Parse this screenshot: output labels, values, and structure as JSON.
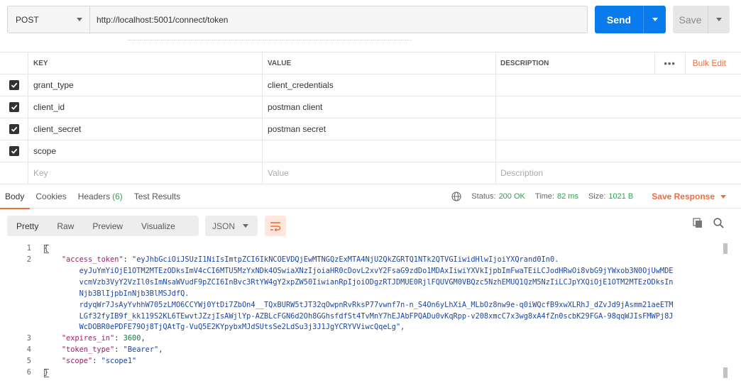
{
  "request": {
    "method": "POST",
    "url": "http://localhost:5001/connect/token",
    "send_label": "Send",
    "save_label": "Save"
  },
  "params": {
    "headers": {
      "key": "KEY",
      "value": "VALUE",
      "description": "DESCRIPTION",
      "more": "•••",
      "bulk_edit": "Bulk Edit"
    },
    "rows": [
      {
        "key": "grant_type",
        "value": "client_credentials",
        "checked": true
      },
      {
        "key": "client_id",
        "value": "postman client",
        "checked": true
      },
      {
        "key": "client_secret",
        "value": "postman secret",
        "checked": true
      },
      {
        "key": "scope",
        "value": "",
        "checked": true
      }
    ],
    "placeholders": {
      "key": "Key",
      "value": "Value",
      "description": "Description"
    }
  },
  "response_tabs": {
    "body": "Body",
    "cookies": "Cookies",
    "headers": "Headers",
    "headers_count": "(6)",
    "test_results": "Test Results"
  },
  "response_meta": {
    "status_label": "Status:",
    "status": "200 OK",
    "time_label": "Time:",
    "time": "82 ms",
    "size_label": "Size:",
    "size": "1021 B",
    "save_response": "Save Response"
  },
  "view_modes": [
    "Pretty",
    "Raw",
    "Preview",
    "Visualize"
  ],
  "format": "JSON",
  "colors": {
    "accent": "#f26b3a",
    "send": "#097bed",
    "ok": "#28a745"
  },
  "code": {
    "line_numbers": [
      "1",
      "2",
      "3",
      "4",
      "5",
      "6"
    ],
    "lines": [
      "{",
      "    \"access_token\": \"eyJhbGciOiJSUzI1NiIsImtpZCI6IkNCOEVDQjEwMTNGQzExMTA4NjU2QkZGRTQ1NTk2QTVGIiwidHlwIjoiYXQrand0In0.",
      "        eyJuYmYiOjE1OTM2MTEzODksImV4cCI6MTU5MzYxNDk4OSwiaXNzIjoiaHR0cDovL2xvY2FsaG9zdDo1MDAxIiwiYXVkIjpbImFwaTEiLCJodHRwOi8vbG9jYWxob3N0OjUwMDE",
      "        vcmVzb3VyY2VzIl0sImNsaWVudF9pZCI6InBvc3RtYW4gY2xpZW50IiwianRpIjoiODgzRTJDMUE0RjlFQUVGM0VBQzc5NzhEMUQ1QzM5NzIiLCJpYXQiOjE1OTM2MTEzODksIn",
      "        Njb3BlIjpbInNjb3BlMSJdfQ.",
      "        rdyqWr7JsAyYvhhW705zLMO6CCYWj0YtDi7ZbOn4__TQxBURW5tJT32qOwpnRvRksP77vwnf7n-n_S4On6yLhXiA_MLbOz8nw9e-q0iWQcfB9xwXLRhJ_dZvJd9jAsmm21aeETM",
      "        LGf32fyIB9f_kk119S2KL6TEwvtJZzjIsAWjlYp-AZBLcFGN6d2Oh8GGhsfdfSt4TvMnY7hEJAbFPQADu0vKqRpp-v208xmcC7x3wg8xA4fZn0scbK29FGA-98qqWJIsFMWPj8J",
      "        WcDOBR0ePDFE79Oj8TjQAtTg-VuQ5E2KYpybxMJdSUtsSe2LdSu3j3J1JgYCRYVViwcQqeLg\",",
      "    \"expires_in\": 3600,",
      "    \"token_type\": \"Bearer\",",
      "    \"scope\": \"scope1\"",
      "}"
    ]
  }
}
